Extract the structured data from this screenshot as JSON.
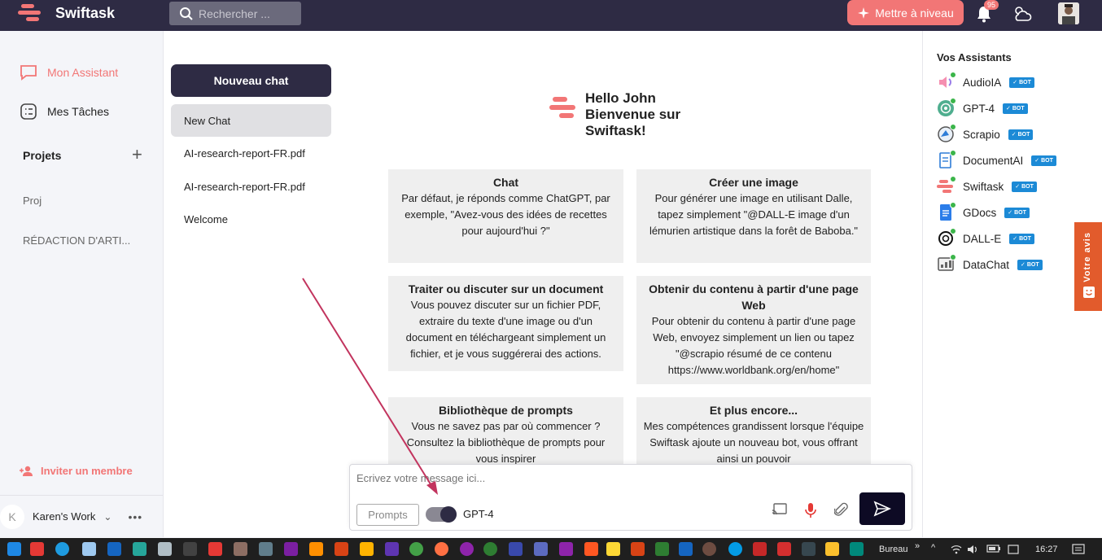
{
  "topbar": {
    "brand": "Swiftask",
    "search_placeholder": "Rechercher ...",
    "upgrade_label": "Mettre à niveau",
    "notification_count": "95"
  },
  "leftnav": {
    "items": [
      {
        "label": "Mon Assistant"
      },
      {
        "label": "Mes Tâches"
      }
    ],
    "projects_title": "Projets",
    "projects": [
      "Proj",
      "RÉDACTION D'ARTI..."
    ],
    "invite_label": "Inviter un membre",
    "workspace_initial": "K",
    "workspace_name": "Karen's Work"
  },
  "chatlist": {
    "new_chat_label": "Nouveau chat",
    "chats": [
      "New Chat",
      "AI-research-report-FR.pdf",
      "AI-research-report-FR.pdf",
      "Welcome"
    ]
  },
  "main": {
    "greeting_line1": "Hello John",
    "greeting_line2": "Bienvenue sur",
    "greeting_line3": "Swiftask!",
    "cards": [
      {
        "title": "Chat",
        "body": "Par défaut, je réponds comme ChatGPT, par exemple, \"Avez-vous des idées de recettes pour aujourd'hui ?\""
      },
      {
        "title": "Créer une image",
        "body": "Pour générer une image en utilisant Dalle, tapez simplement \"@DALL-E image d'un lémurien artistique dans la forêt de Baboba.\""
      },
      {
        "title": "Traiter ou discuter sur un document",
        "body": "Vous pouvez discuter sur un fichier PDF, extraire du texte d'une image ou d'un document en téléchargeant simplement un fichier, et je vous suggérerai des actions."
      },
      {
        "title": "Obtenir du contenu à partir d'une page Web",
        "body": "Pour obtenir du contenu à partir d'une page Web, envoyez simplement un lien ou tapez \"@scrapio résumé de ce contenu https://www.worldbank.org/en/home\""
      },
      {
        "title": "Bibliothèque de prompts",
        "body": "Vous ne savez pas par où commencer ? Consultez la bibliothèque de prompts pour vous inspirer"
      },
      {
        "title": "Et plus encore...",
        "body": "Mes compétences grandissent lorsque l'équipe Swiftask ajoute un nouveau bot, vous offrant ainsi un pouvoir"
      }
    ]
  },
  "composer": {
    "placeholder": "Ecrivez votre message ici...",
    "prompts_label": "Prompts",
    "model_label": "GPT-4"
  },
  "assistants": {
    "title": "Vos Assistants",
    "bot_label": "✓ BOT",
    "items": [
      {
        "name": "AudioIA",
        "icon": "audio-icon"
      },
      {
        "name": "GPT-4",
        "icon": "openai-icon"
      },
      {
        "name": "Scrapio",
        "icon": "scrapio-icon"
      },
      {
        "name": "DocumentAI",
        "icon": "document-icon"
      },
      {
        "name": "Swiftask",
        "icon": "swiftask-icon"
      },
      {
        "name": "GDocs",
        "icon": "gdocs-icon"
      },
      {
        "name": "DALL-E",
        "icon": "openai-icon"
      },
      {
        "name": "DataChat",
        "icon": "datachat-icon"
      }
    ]
  },
  "feedback_label": "Votre avis",
  "taskbar": {
    "bureau_label": "Bureau",
    "time": "16:27"
  },
  "colors": {
    "brand_dark": "#2e2b44",
    "accent_coral": "#f27676",
    "bot_blue": "#1c8ad6",
    "feedback_orange": "#e25b2c"
  }
}
